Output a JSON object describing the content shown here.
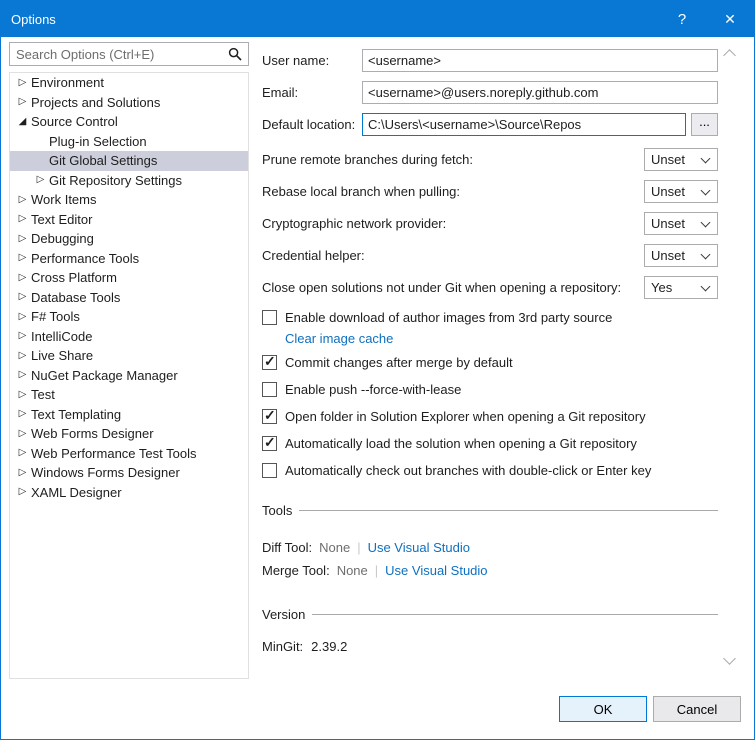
{
  "window": {
    "title": "Options",
    "icons": {
      "help": "?",
      "close": "✕",
      "search": "magnifier",
      "combo_arrow": "chevron-down",
      "expander_collapsed": "triangle-right",
      "expander_expanded": "triangle-expanded",
      "scroll_up": "chevron-up",
      "scroll_down": "chevron-down",
      "checkbox_check": "checkmark"
    }
  },
  "search": {
    "placeholder": "Search Options (Ctrl+E)"
  },
  "tree": {
    "items": [
      {
        "label": "Environment",
        "state": "collapsed"
      },
      {
        "label": "Projects and Solutions",
        "state": "collapsed"
      },
      {
        "label": "Source Control",
        "state": "expanded"
      },
      {
        "label": "Plug-in Selection",
        "state": "leaf"
      },
      {
        "label": "Git Global Settings",
        "state": "leaf",
        "selected": true
      },
      {
        "label": "Git Repository Settings",
        "state": "collapsed"
      },
      {
        "label": "Work Items",
        "state": "collapsed"
      },
      {
        "label": "Text Editor",
        "state": "collapsed"
      },
      {
        "label": "Debugging",
        "state": "collapsed"
      },
      {
        "label": "Performance Tools",
        "state": "collapsed"
      },
      {
        "label": "Cross Platform",
        "state": "collapsed"
      },
      {
        "label": "Database Tools",
        "state": "collapsed"
      },
      {
        "label": "F# Tools",
        "state": "collapsed"
      },
      {
        "label": "IntelliCode",
        "state": "collapsed"
      },
      {
        "label": "Live Share",
        "state": "collapsed"
      },
      {
        "label": "NuGet Package Manager",
        "state": "collapsed"
      },
      {
        "label": "Test",
        "state": "collapsed"
      },
      {
        "label": "Text Templating",
        "state": "collapsed"
      },
      {
        "label": "Web Forms Designer",
        "state": "collapsed"
      },
      {
        "label": "Web Performance Test Tools",
        "state": "collapsed"
      },
      {
        "label": "Windows Forms Designer",
        "state": "collapsed"
      },
      {
        "label": "XAML Designer",
        "state": "collapsed"
      }
    ]
  },
  "form": {
    "fields": [
      {
        "label": "User name:",
        "value": "<username>"
      },
      {
        "label": "Email:",
        "value": "<username>@users.noreply.github.com"
      },
      {
        "label": "Default location:",
        "value": "C:\\Users\\<username>\\Source\\Repos",
        "browse_label": "..."
      }
    ],
    "dropdowns": [
      {
        "label": "Prune remote branches during fetch:",
        "value": "Unset"
      },
      {
        "label": "Rebase local branch when pulling:",
        "value": "Unset"
      },
      {
        "label": "Cryptographic network provider:",
        "value": "Unset"
      },
      {
        "label": "Credential helper:",
        "value": "Unset"
      },
      {
        "label": "Close open solutions not under Git when opening a repository:",
        "value": "Yes"
      }
    ],
    "checkboxes": [
      {
        "label": "Enable download of author images from 3rd party source",
        "checked": false
      },
      {
        "label": "Commit changes after merge by default",
        "checked": true
      },
      {
        "label": "Enable push --force-with-lease",
        "checked": false
      },
      {
        "label": "Open folder in Solution Explorer when opening a Git repository",
        "checked": true
      },
      {
        "label": "Automatically load the solution when opening a Git repository",
        "checked": true
      },
      {
        "label": "Automatically check out branches with double-click or Enter key",
        "checked": false
      }
    ],
    "clear_image_cache_link": "Clear image cache"
  },
  "tools": {
    "title": "Tools",
    "separator": "|",
    "rows": [
      {
        "label": "Diff Tool:",
        "value": "None",
        "link": "Use Visual Studio"
      },
      {
        "label": "Merge Tool:",
        "value": "None",
        "link": "Use Visual Studio"
      }
    ]
  },
  "version": {
    "title": "Version",
    "label": "MinGit:",
    "value": "2.39.2"
  },
  "footer": {
    "ok": "OK",
    "cancel": "Cancel"
  }
}
